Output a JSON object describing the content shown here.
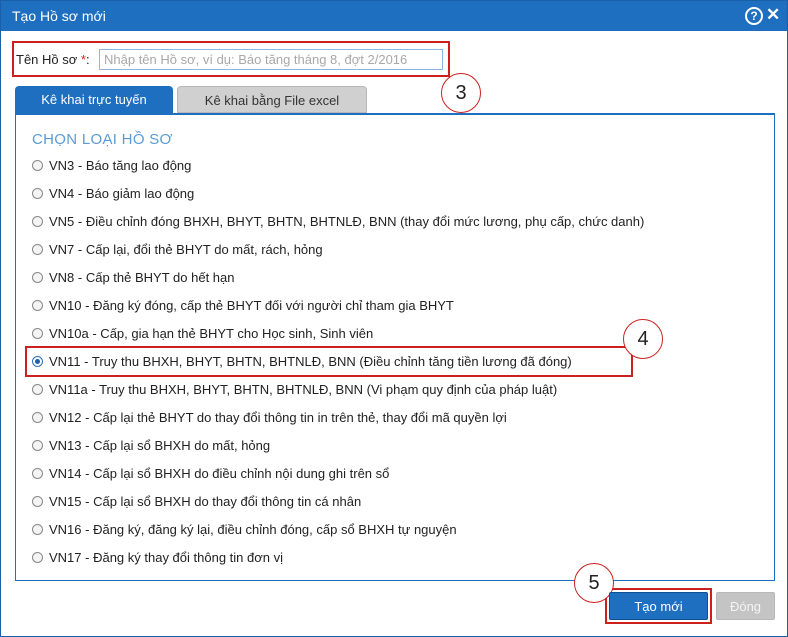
{
  "dialog": {
    "title": "Tạo Hồ sơ mới",
    "help_glyph": "?",
    "close_glyph": "✕"
  },
  "name_field": {
    "label": "Tên Hồ sơ",
    "required_mark": "*",
    "colon": ":",
    "value": "",
    "placeholder": "Nhập tên Hồ sơ, ví dụ: Báo tăng tháng 8, đợt 2/2016"
  },
  "tabs": [
    {
      "label": "Kê khai trực tuyến",
      "active": true
    },
    {
      "label": "Kê khai bằng File excel",
      "active": false
    }
  ],
  "section_title": "CHỌN LOẠI HỒ SƠ",
  "options": [
    {
      "label": "VN3 - Báo tăng lao động",
      "checked": false
    },
    {
      "label": "VN4 - Báo giảm lao động",
      "checked": false
    },
    {
      "label": "VN5 - Điều chỉnh đóng BHXH, BHYT, BHTN, BHTNLĐ, BNN (thay đổi mức lương, phụ cấp, chức danh)",
      "checked": false
    },
    {
      "label": "VN7 - Cấp lại, đổi thẻ BHYT do mất, rách, hỏng",
      "checked": false
    },
    {
      "label": "VN8 - Cấp thẻ BHYT do hết hạn",
      "checked": false
    },
    {
      "label": "VN10 - Đăng ký đóng, cấp thẻ BHYT đối với người chỉ tham gia BHYT",
      "checked": false
    },
    {
      "label": "VN10a - Cấp, gia hạn thẻ BHYT cho Học sinh, Sinh viên",
      "checked": false
    },
    {
      "label": "VN11 - Truy thu BHXH, BHYT, BHTN, BHTNLĐ, BNN (Điều chỉnh tăng tiền lương đã đóng)",
      "checked": true
    },
    {
      "label": "VN11a - Truy thu BHXH, BHYT, BHTN, BHTNLĐ, BNN (Vi phạm quy định của pháp luật)",
      "checked": false
    },
    {
      "label": "VN12 - Cấp lại thẻ BHYT do thay đổi thông tin in trên thẻ, thay đổi mã quyền lợi",
      "checked": false
    },
    {
      "label": "VN13 - Cấp lại sổ BHXH do mất, hỏng",
      "checked": false
    },
    {
      "label": "VN14 - Cấp lại sổ BHXH do điều chỉnh nội dung ghi trên sổ",
      "checked": false
    },
    {
      "label": "VN15 - Cấp lại sổ BHXH do thay đổi thông tin cá nhân",
      "checked": false
    },
    {
      "label": "VN16 - Đăng ký, đăng ký lại, điều chỉnh đóng, cấp sổ BHXH tự nguyện",
      "checked": false
    },
    {
      "label": "VN17 - Đăng ký thay đổi thông tin đơn vị",
      "checked": false
    }
  ],
  "callouts": {
    "name_field": "3",
    "selected_option": "4",
    "create_button": "5"
  },
  "buttons": {
    "create": "Tạo mới",
    "close": "Đóng"
  },
  "colors": {
    "titlebar": "#1e6fbf",
    "annotation": "#cc2020",
    "section_title": "#5b9bd5"
  }
}
